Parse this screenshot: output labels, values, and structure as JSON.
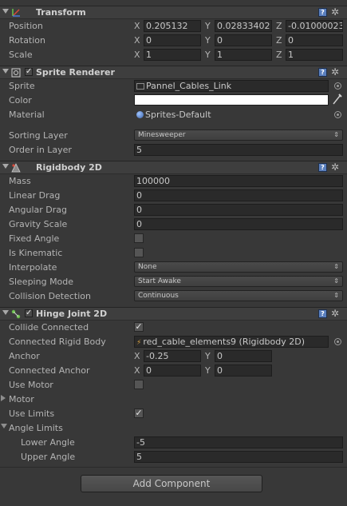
{
  "transform": {
    "title": "Transform",
    "position_label": "Position",
    "position": {
      "x_label": "X",
      "x": "0.205132",
      "y_label": "Y",
      "y": "0.02833402",
      "z_label": "Z",
      "z": "-0.01000023"
    },
    "rotation_label": "Rotation",
    "rotation": {
      "x_label": "X",
      "x": "0",
      "y_label": "Y",
      "y": "0",
      "z_label": "Z",
      "z": "0"
    },
    "scale_label": "Scale",
    "scale": {
      "x_label": "X",
      "x": "1",
      "y_label": "Y",
      "y": "1",
      "z_label": "Z",
      "z": "1"
    }
  },
  "sprite_renderer": {
    "title": "Sprite Renderer",
    "sprite_label": "Sprite",
    "sprite_value": "Pannel_Cables_Link",
    "color_label": "Color",
    "color_value": "#ffffff",
    "material_label": "Material",
    "material_value": "Sprites-Default",
    "sorting_layer_label": "Sorting Layer",
    "sorting_layer_value": "Minesweeper",
    "order_label": "Order in Layer",
    "order_value": "5"
  },
  "rigidbody": {
    "title": "Rigidbody 2D",
    "mass_label": "Mass",
    "mass": "100000",
    "linear_drag_label": "Linear Drag",
    "linear_drag": "0",
    "angular_drag_label": "Angular Drag",
    "angular_drag": "0",
    "gravity_label": "Gravity Scale",
    "gravity": "0",
    "fixed_angle_label": "Fixed Angle",
    "fixed_angle": false,
    "kinematic_label": "Is Kinematic",
    "kinematic": false,
    "interpolate_label": "Interpolate",
    "interpolate": "None",
    "sleeping_label": "Sleeping Mode",
    "sleeping": "Start Awake",
    "collision_label": "Collision Detection",
    "collision": "Continuous"
  },
  "hinge": {
    "title": "Hinge Joint 2D",
    "collide_label": "Collide Connected",
    "collide": true,
    "connected_body_label": "Connected Rigid Body",
    "connected_body": "red_cable_elements9 (Rigidbody 2D)",
    "anchor_label": "Anchor",
    "anchor": {
      "x_label": "X",
      "x": "-0.25",
      "y_label": "Y",
      "y": "0"
    },
    "connected_anchor_label": "Connected Anchor",
    "connected_anchor": {
      "x_label": "X",
      "x": "0",
      "y_label": "Y",
      "y": "0"
    },
    "use_motor_label": "Use Motor",
    "use_motor": false,
    "motor_label": "Motor",
    "use_limits_label": "Use Limits",
    "use_limits": true,
    "angle_limits_label": "Angle Limits",
    "lower_angle_label": "Lower Angle",
    "lower_angle": "-5",
    "upper_angle_label": "Upper Angle",
    "upper_angle": "5"
  },
  "add_component_label": "Add Component",
  "colors": {
    "background": "#383838",
    "header": "#3e3e3e",
    "field": "#2a2a2a",
    "help": "#5a7fbd"
  }
}
